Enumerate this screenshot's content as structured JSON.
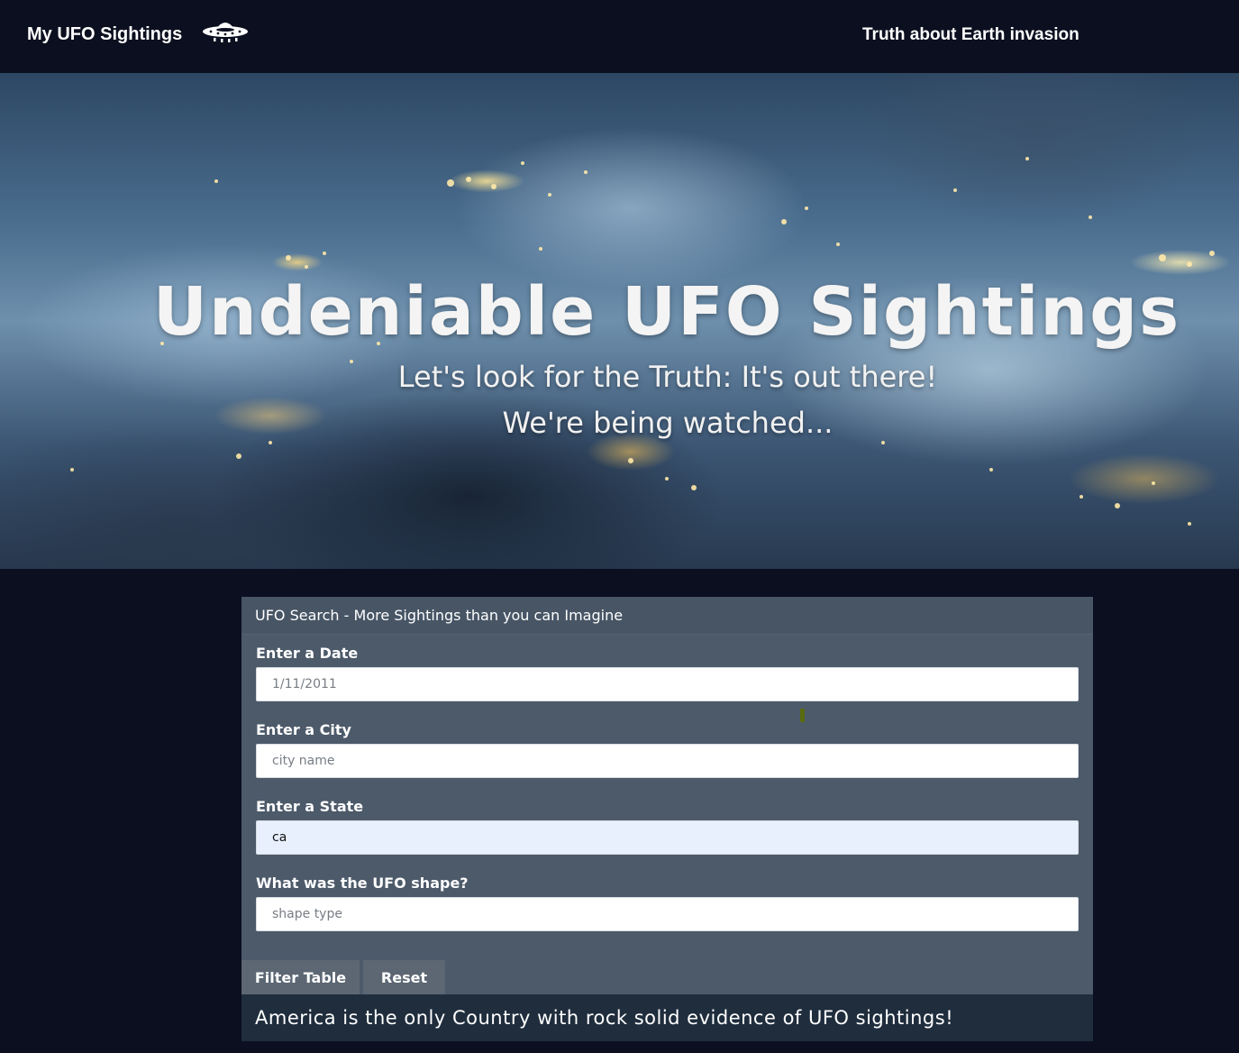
{
  "navbar": {
    "brand": "My UFO Sightings",
    "brand_icon": "ufo-icon",
    "link": "Truth about Earth invasion"
  },
  "hero": {
    "title": "Undeniable UFO Sightings",
    "subtitle1": "Let's look for the Truth: It's out there!",
    "subtitle2": "We're being watched..."
  },
  "search": {
    "header": "UFO Search - More Sightings than you can Imagine",
    "date": {
      "label": "Enter a Date",
      "placeholder": "1/11/2011",
      "value": ""
    },
    "city": {
      "label": "Enter a City",
      "placeholder": "city name",
      "value": ""
    },
    "state": {
      "label": "Enter a State",
      "placeholder": "",
      "value": "ca"
    },
    "shape": {
      "label": "What was the UFO shape?",
      "placeholder": "shape type",
      "value": ""
    },
    "filter_button": "Filter Table",
    "reset_button": "Reset",
    "footer": "America is the only Country with rock solid evidence of UFO sightings!"
  },
  "colors": {
    "page_bg": "#0b0f1f",
    "panel_bg": "#4c5a6a",
    "footer_bg": "#1f2d3d",
    "autofill_bg": "#e8f0fe"
  }
}
